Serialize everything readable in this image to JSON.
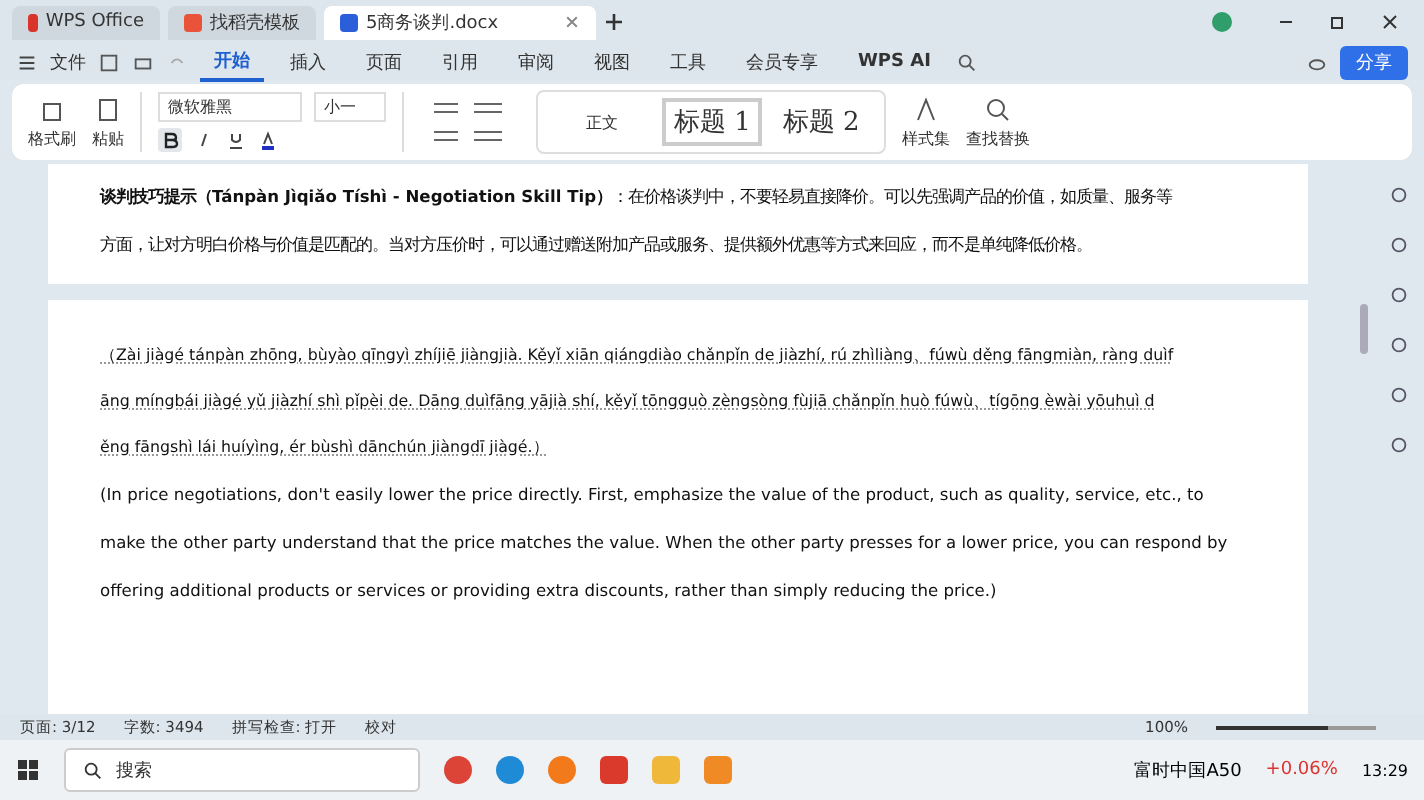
{
  "window_tabs": [
    {
      "label": "WPS Office",
      "kind": "home",
      "selected": false
    },
    {
      "label": "找稻壳模板",
      "kind": "template",
      "selected": false
    },
    {
      "label": "5商务谈判.docx",
      "kind": "doc",
      "selected": true
    }
  ],
  "menu": {
    "file": "文件",
    "tabs": [
      {
        "label": "开始",
        "selected": true
      },
      {
        "label": "插入",
        "selected": false
      },
      {
        "label": "页面",
        "selected": false
      },
      {
        "label": "引用",
        "selected": false
      },
      {
        "label": "审阅",
        "selected": false
      },
      {
        "label": "视图",
        "selected": false
      },
      {
        "label": "工具",
        "selected": false
      },
      {
        "label": "会员专享",
        "selected": false
      }
    ],
    "ai": "WPS AI",
    "share": "分享"
  },
  "ribbon": {
    "format_painter": "格式刷",
    "paste": "粘贴",
    "font": "微软雅黑",
    "size": "小一",
    "bold_on": true,
    "styles": [
      "正文",
      "标题 1",
      "标题 2"
    ],
    "style_set": "样式集",
    "find_replace": "查找替换"
  },
  "document": {
    "page_1": [
      "**谈判技巧提示（Tánpàn Jìqiǎo Tíshì - Negotiation Skill Tip）**：在价格谈判中，不要轻易直接降价。可以先强调产品的价值，如质量、服务等",
      "方面，让对方明白价格与价值是匹配的。当对方压价时，可以通过赠送附加产品或服务、提供额外优惠等方式来回应，而不是单纯降低价格。"
    ],
    "pinyin": [
      "（Zài jiàgé tánpàn zhōng, bùyào qīngyì zhíjiē  jiàngjià. Kěyǐ xiān qiángdiào chǎnpǐn de jiàzhí, rú zhìliàng、fúwù děng fāngmiàn, ràng duìf",
      "āng míngbái jiàgé yǔ jiàzhí shì pǐpèi de. Dāng duìfāng yājià shí, kěyǐ tōngguò zèngsòng fùjiā  chǎnpǐn huò fúwù、tígōng èwài yōuhuì d",
      "ěng fāngshì lái huíyìng, ér bùshì dānchún jiàngdī  jiàgé.）"
    ],
    "english": [
      "(In price negotiations, don't easily lower the price directly. First, emphasize the value of the product, such as quality, service, etc., to",
      "make the other party understand that the price matches the value. When the other party presses for a lower price, you can respond by",
      "offering additional products or services or providing extra discounts, rather than simply reducing the price.)"
    ]
  },
  "status_bar": {
    "page": "页面: 3/12",
    "words": "字数: 3494",
    "spell": "拼写检查: 打开",
    "proof": "校对",
    "zoom": "100%",
    "level": 0.7
  },
  "taskbar": {
    "search": "搜索",
    "stock": "富时中国A50",
    "change": "+0.06%",
    "time": "13:29"
  }
}
